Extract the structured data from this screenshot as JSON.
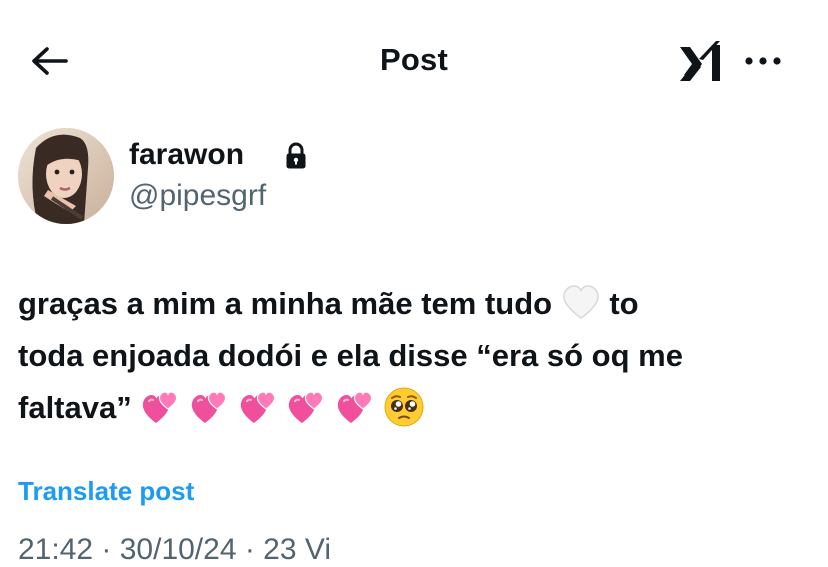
{
  "header": {
    "title": "Post",
    "back_icon": "arrow-left-icon",
    "grok_icon": "grok-icon",
    "more_icon": "more-horizontal-icon"
  },
  "author": {
    "display_name": "farawon",
    "handle": "@pipesgrf",
    "protected_icon": "lock-icon"
  },
  "post": {
    "line1": "graças a mim a minha mãe tem tudo",
    "line1_end": "to",
    "line2": "toda enjoada dodói e ela disse “era só oq me",
    "line3": "faltava”",
    "emojis": [
      "white-heart-icon",
      "two-hearts-icon",
      "two-hearts-icon",
      "two-hearts-icon",
      "two-hearts-icon",
      "two-hearts-icon",
      "pleading-face-icon"
    ]
  },
  "translate_label": "Translate post",
  "meta": {
    "partial": "21:42 · 30/10/24 · 23 Vi"
  },
  "colors": {
    "text": "#0f1419",
    "secondary": "#536471",
    "accent": "#1d9bf0",
    "heart_pink": "#f04f9c"
  }
}
